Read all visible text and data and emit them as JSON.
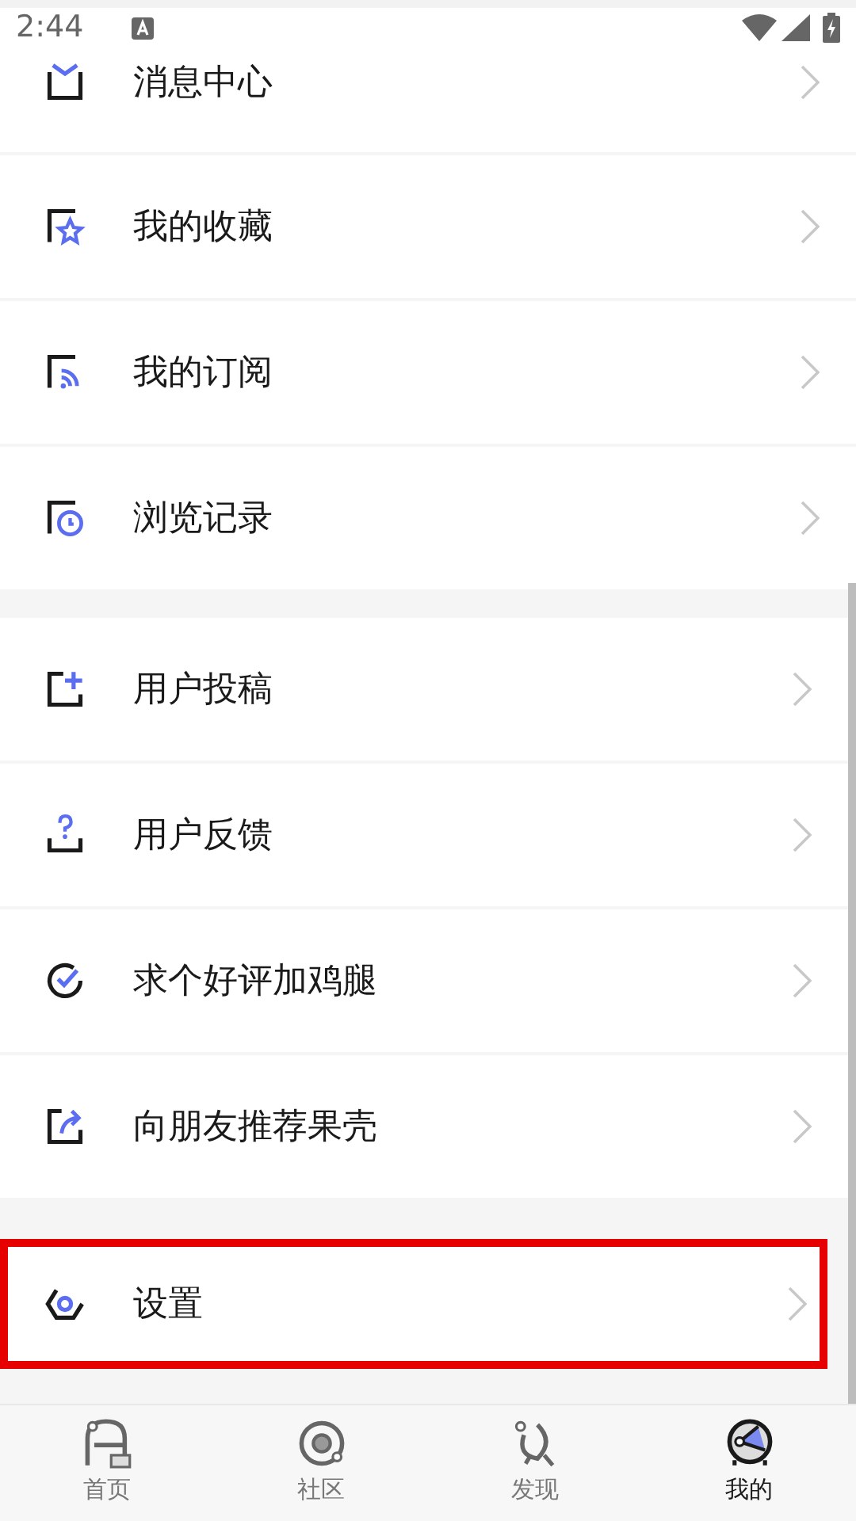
{
  "status_bar": {
    "time": "2:44"
  },
  "menu_groups": [
    {
      "items": [
        {
          "label": "消息中心",
          "highlighted": false
        },
        {
          "label": "我的收藏",
          "highlighted": false
        },
        {
          "label": "我的订阅",
          "highlighted": false
        },
        {
          "label": "浏览记录",
          "highlighted": false
        }
      ]
    },
    {
      "items": [
        {
          "label": "用户投稿",
          "highlighted": false
        },
        {
          "label": "用户反馈",
          "highlighted": false
        },
        {
          "label": "求个好评加鸡腿",
          "highlighted": false
        },
        {
          "label": "向朋友推荐果壳",
          "highlighted": false
        }
      ]
    },
    {
      "items": [
        {
          "label": "设置",
          "highlighted": true
        }
      ]
    }
  ],
  "tab_bar": [
    {
      "label": "首页",
      "selected": false
    },
    {
      "label": "社区",
      "selected": false
    },
    {
      "label": "发现",
      "selected": false
    },
    {
      "label": "我的",
      "selected": true
    }
  ]
}
